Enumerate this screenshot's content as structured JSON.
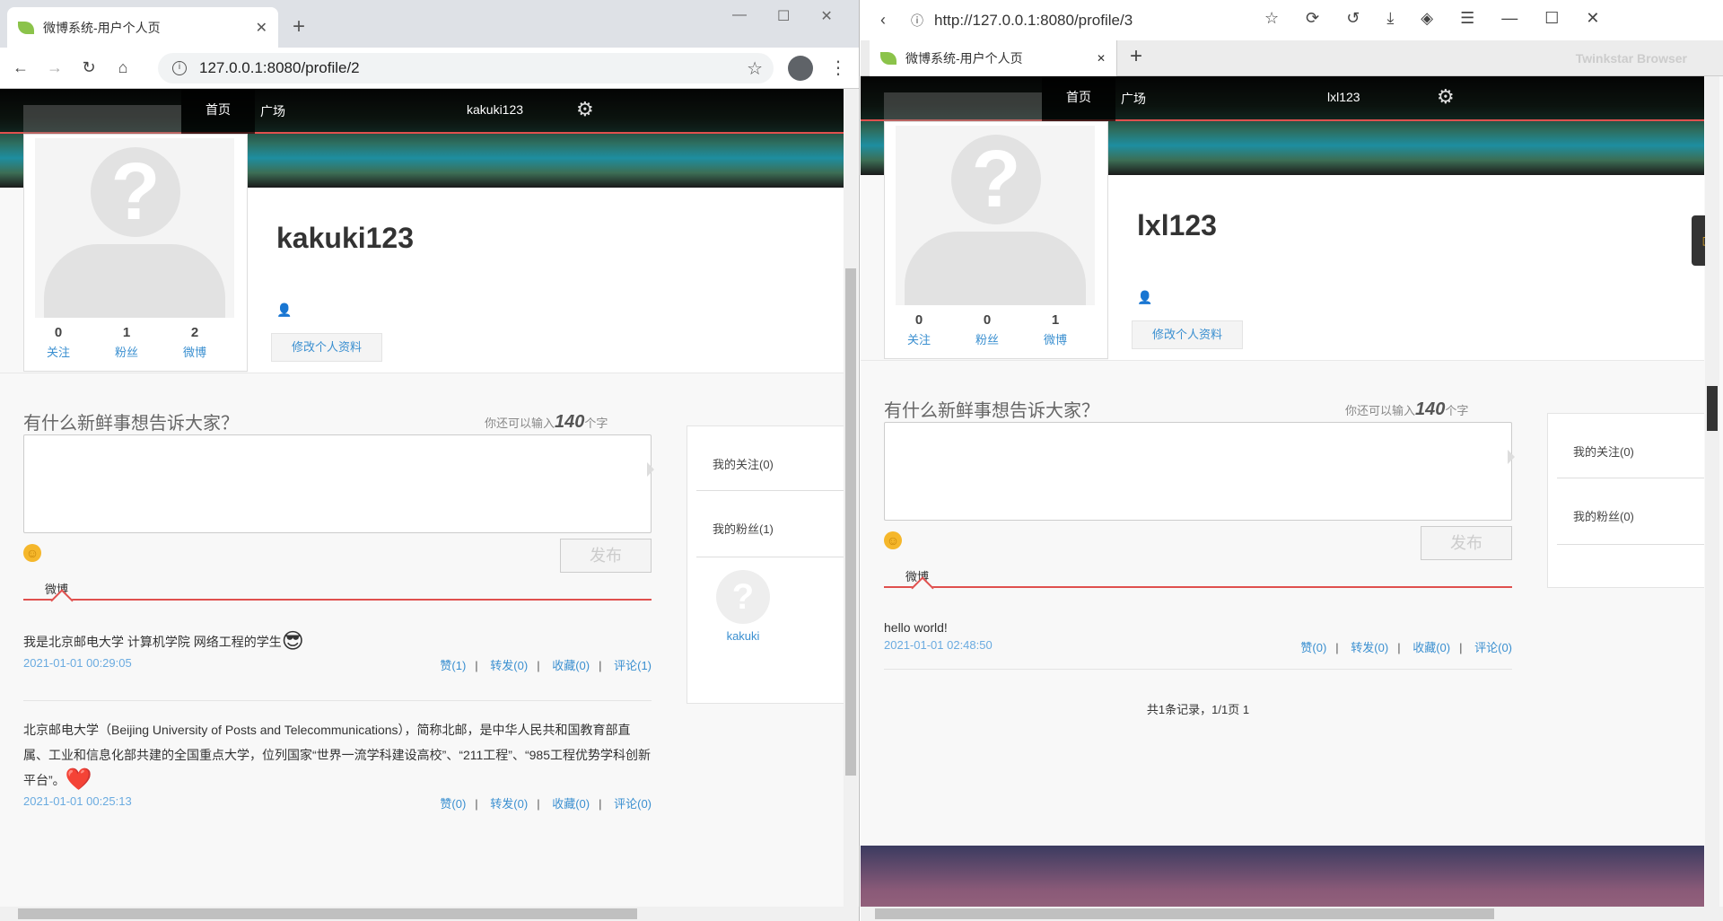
{
  "left": {
    "tab_title": "微博系统-用户个人页",
    "tab_close": "✕",
    "new_tab": "+",
    "url": "127.0.0.1:8080/profile/2",
    "nav": {
      "home": "首页",
      "square": "广场",
      "user": "kakuki123"
    },
    "profile": {
      "username": "kakuki123",
      "follow_count": "0",
      "follow_label": "关注",
      "fans_count": "1",
      "fans_label": "粉丝",
      "weibo_count": "2",
      "weibo_label": "微博",
      "edit_label": "修改个人资料"
    },
    "composer": {
      "prompt": "有什么新鲜事想告诉大家？",
      "remaining_prefix": "你还可以输入",
      "remaining": "140",
      "remaining_suffix": "个字",
      "publish": "发布",
      "tab": "微博"
    },
    "posts": [
      {
        "text": "我是北京邮电大学 计算机学院 网络工程的学生",
        "emoji": "😎",
        "time": "2021-01-01 00:29:05",
        "like": "赞(1)",
        "forward": "转发(0)",
        "collect": "收藏(0)",
        "comment": "评论(1)"
      },
      {
        "text": "北京邮电大学（Beijing University of Posts and Telecommunications），简称北邮，是中华人民共和国教育部直属、工业和信息化部共建的全国重点大学，位列国家“世界一流学科建设高校”、“211工程”、“985工程优势学科创新平台”。",
        "emoji": "❤️",
        "time": "2021-01-01 00:25:13",
        "like": "赞(0)",
        "forward": "转发(0)",
        "collect": "收藏(0)",
        "comment": "评论(0)"
      }
    ],
    "sidebar": {
      "following": "我的关注(0)",
      "fans": "我的粉丝(1)",
      "fan_name": "kakuki"
    }
  },
  "right": {
    "tab_title": "微博系统-用户个人页",
    "tab_close": "✕",
    "new_tab": "+",
    "url": "http://127.0.0.1:8080/profile/3",
    "brand": "Twinkstar Browser",
    "nav": {
      "home": "首页",
      "square": "广场",
      "user": "lxl123"
    },
    "profile": {
      "username": "lxl123",
      "follow_count": "0",
      "follow_label": "关注",
      "fans_count": "0",
      "fans_label": "粉丝",
      "weibo_count": "1",
      "weibo_label": "微博",
      "edit_label": "修改个人资料"
    },
    "composer": {
      "prompt": "有什么新鲜事想告诉大家？",
      "remaining_prefix": "你还可以输入",
      "remaining": "140",
      "remaining_suffix": "个字",
      "publish": "发布",
      "tab": "微博"
    },
    "posts": [
      {
        "text": "hello world!",
        "time": "2021-01-01 02:48:50",
        "like": "赞(0)",
        "forward": "转发(0)",
        "collect": "收藏(0)",
        "comment": "评论(0)"
      }
    ],
    "pager": "共1条记录，1/1页 1",
    "sidebar": {
      "following": "我的关注(0)",
      "fans": "我的粉丝(0)"
    }
  }
}
